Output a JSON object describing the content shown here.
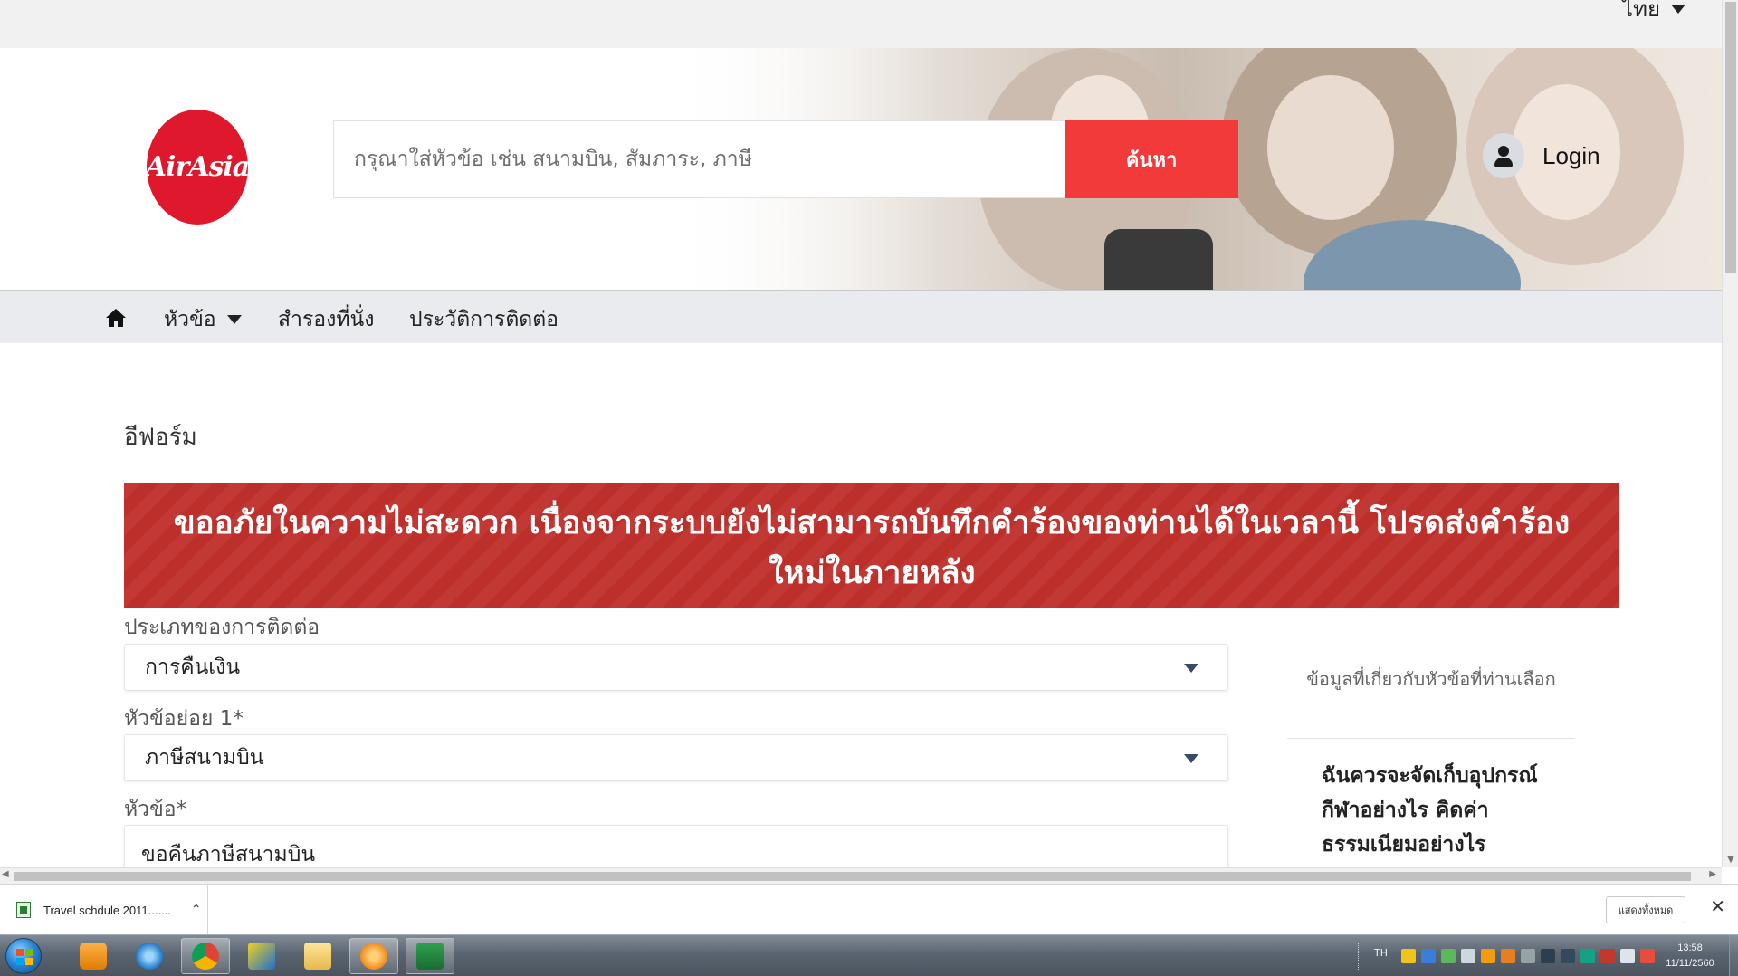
{
  "language": {
    "current": "ไทย"
  },
  "header": {
    "logo_text": "AirAsia",
    "search_placeholder": "กรุณาใส่หัวข้อ เช่น สนามบิน, สัมภาระ, ภาษี",
    "search_button": "ค้นหา",
    "login_label": "Login"
  },
  "nav": {
    "items": [
      {
        "label": "หัวข้อ",
        "has_dropdown": true
      },
      {
        "label": "สำรองที่นั่ง"
      },
      {
        "label": "ประวัติการติดต่อ"
      }
    ]
  },
  "page": {
    "title": "อีฟอร์ม",
    "alert": "ขออภัยในความไม่สะดวก เนื่องจากระบบยังไม่สามารถบันทึกคำร้องของท่านได้ในเวลานี้ โปรดส่งคำร้องใหม่ในภายหลัง",
    "alert_color": "#c0302c"
  },
  "form": {
    "fields": [
      {
        "label": "ประเภทของการติดต่อ",
        "value": "การคืนเงิน",
        "type": "select"
      },
      {
        "label": "หัวข้อย่อย 1*",
        "value": "ภาษีสนามบิน",
        "type": "select"
      },
      {
        "label": "หัวข้อ*",
        "value": "ขอคืนภาษีสนามบิน",
        "type": "text"
      }
    ]
  },
  "sidebar": {
    "info_heading": "ข้อมูลที่เกี่ยวกับหัวข้อที่ท่านเลือก",
    "article_title": "ฉันควรจะจัดเก็บอุปกรณ์กีฬาอย่างไร คิดค่าธรรมเนียมอย่างไร"
  },
  "download_bar": {
    "file_name": "Travel schdule 2011.......",
    "show_all": "แสดงทั้งหมด"
  },
  "taskbar": {
    "apps": [
      "windows-media-player",
      "internet-explorer",
      "chrome",
      "winamp",
      "file-explorer",
      "app-orange",
      "excel"
    ],
    "tray_language": "TH",
    "time": "13:58",
    "date": "11/11/2560"
  },
  "colors": {
    "brand_red": "#e0182d",
    "search_button": "#f23a3a",
    "nav_background": "#e9ebee"
  }
}
